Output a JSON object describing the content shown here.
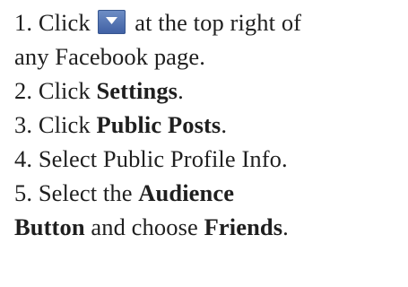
{
  "steps": [
    {
      "num": "1.",
      "parts": [
        {
          "t": "Click",
          "b": false
        },
        {
          "t": "at the top right of",
          "b": false
        }
      ]
    },
    {
      "cont": [
        {
          "t": "any Facebook page.",
          "b": false
        }
      ]
    },
    {
      "num": "2.",
      "parts": [
        {
          "t": "Click",
          "b": false
        },
        {
          "t": "Settings",
          "b": true
        },
        {
          "t": ".",
          "b": false
        }
      ]
    },
    {
      "num": "3.",
      "parts": [
        {
          "t": "Click",
          "b": false
        },
        {
          "t": "Public Posts",
          "b": true
        },
        {
          "t": ".",
          "b": false
        }
      ]
    },
    {
      "num": "4.",
      "parts": [
        {
          "t": "Select Public Profile Info.",
          "b": false
        }
      ]
    },
    {
      "num": "5.",
      "parts": [
        {
          "t": "Select the",
          "b": false
        },
        {
          "t": "Audience",
          "b": true
        }
      ]
    },
    {
      "cont": [
        {
          "t": "Button",
          "b": true
        },
        {
          "t": "and choose",
          "b": false
        },
        {
          "t": "Friends",
          "b": true
        },
        {
          "t": ".",
          "b": false
        }
      ]
    }
  ],
  "icons": {
    "menu_button": "facebook-account-menu-caret-icon",
    "menu_button_color": "#4e6fb0"
  }
}
